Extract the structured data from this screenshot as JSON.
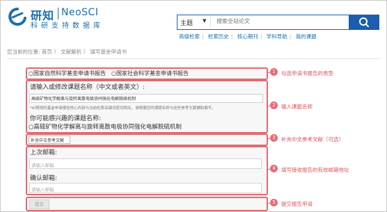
{
  "header": {
    "logo_cn": "研知",
    "logo_en": "NeoSCI",
    "tagline": "科研支持数据库",
    "search_category": "主题",
    "search_placeholder": "搜索全站论文",
    "nav": [
      "高级检索",
      "检索历史",
      "核心期刊",
      "学科导航",
      "我的课题"
    ]
  },
  "breadcrumb": "您当前的位置:  首页  〉  文献解析  〉  填写基金申请书",
  "form": {
    "report_type_options": [
      "国家自然科学基金申请书报告",
      "国家社会科学基金申请书报告"
    ],
    "topic_label": "请输入或修改课题名称（中文或者英文）:",
    "topic_value": "高硫矿物化学解离与旋转离散电极协同强化电解脱硫机制",
    "topic_note": "*AI预测的基金申请报告核心内容与当前检索关键词密切相关，请根据您的课题名称与这些参考文献辅助撰写。",
    "suggest_label": "你可能感兴趣的课题名称:",
    "suggest_value": "高硫矿物化学解离与旋转离散电极协同强化电解脱硫机制",
    "reference_label": "补充中文参考文献",
    "last_email_label": "上次邮箱:",
    "last_email_placeholder": "请输入邮箱",
    "confirm_email_label": "确认邮箱:",
    "confirm_email_placeholder": "请输入邮箱",
    "submit_label": "提交"
  },
  "annotations": [
    {
      "num": "1",
      "text": "勾选申请书报告的类型"
    },
    {
      "num": "2",
      "text": "输入课题名称"
    },
    {
      "num": "3",
      "text": "补充中文参考文献（可选）"
    },
    {
      "num": "4",
      "text": "填写接收报告的有效邮箱地址"
    },
    {
      "num": "5",
      "text": "提交报告申请"
    }
  ],
  "colors": {
    "brand_blue": "#1b5db0",
    "annotation_red": "#e06a70"
  }
}
